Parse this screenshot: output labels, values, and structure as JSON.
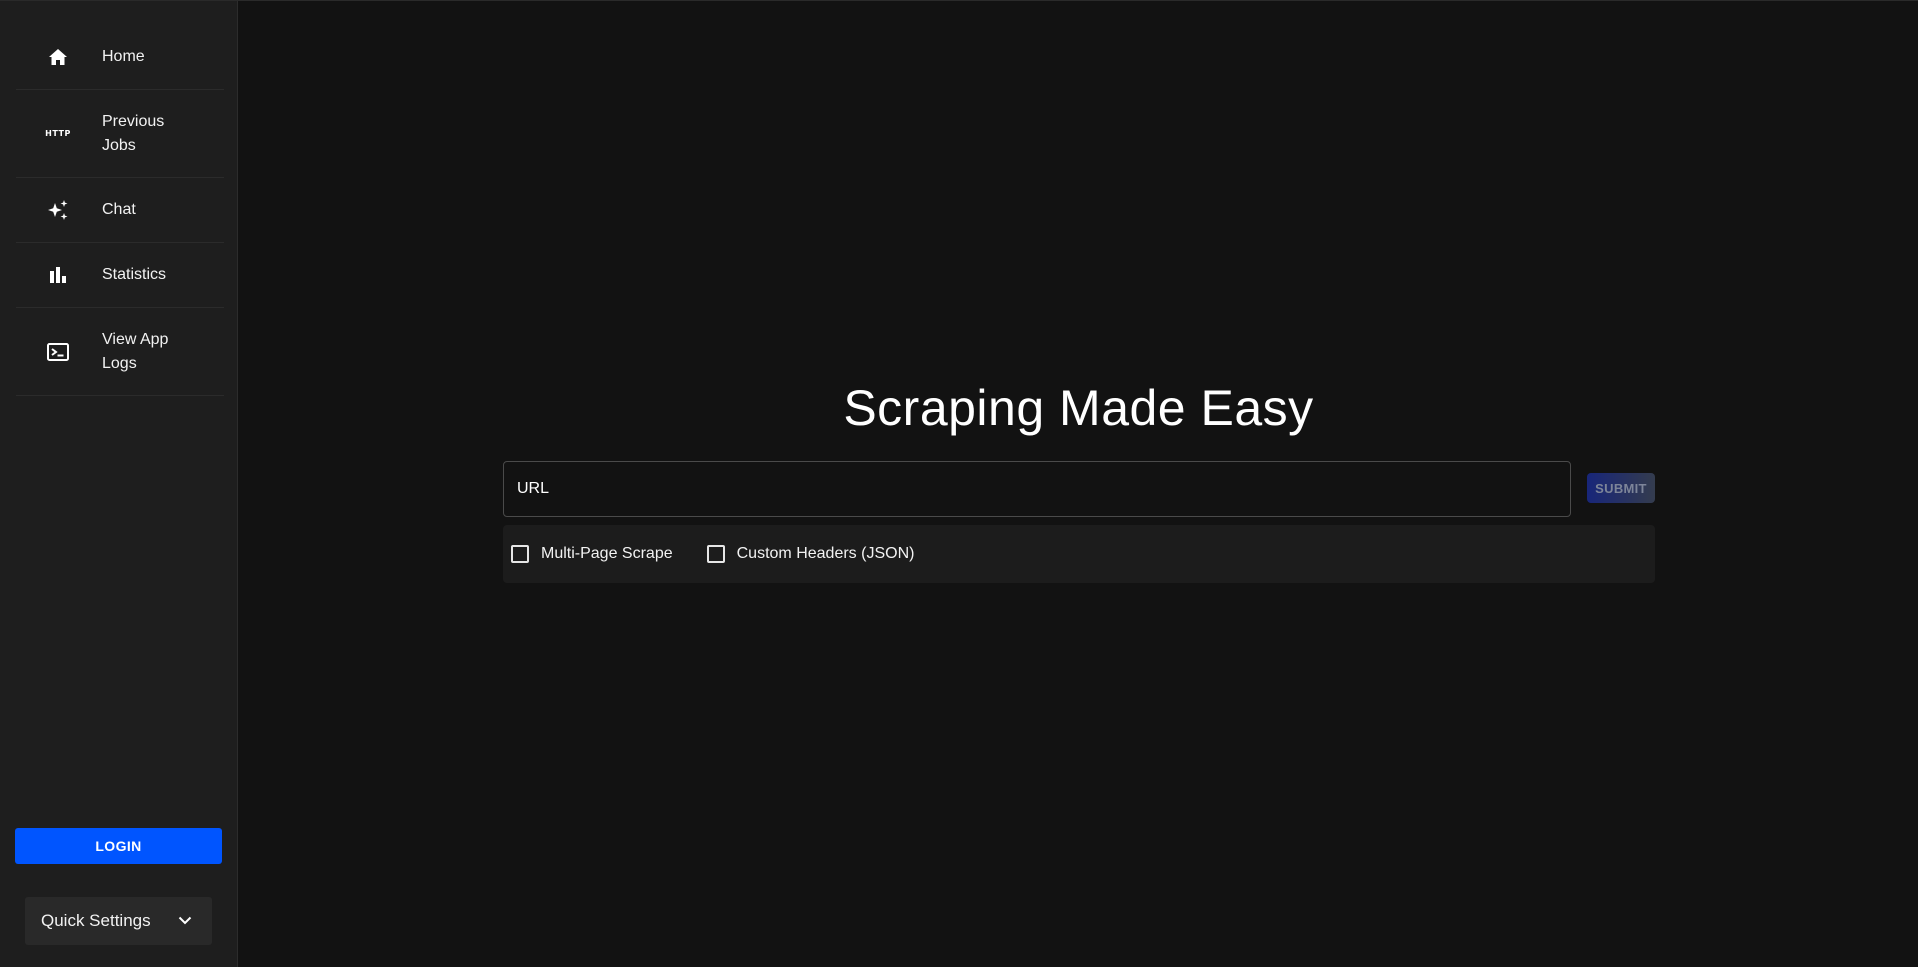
{
  "sidebar": {
    "items": [
      {
        "label": "Home",
        "icon": "home-icon"
      },
      {
        "label": "Previous Jobs",
        "icon": "http-icon",
        "icon_text": "HTTP"
      },
      {
        "label": "Chat",
        "icon": "sparkles-icon"
      },
      {
        "label": "Statistics",
        "icon": "bar-chart-icon"
      },
      {
        "label": "View App Logs",
        "icon": "terminal-icon"
      }
    ],
    "login_label": "LOGIN",
    "quick_settings_label": "Quick Settings"
  },
  "main": {
    "title": "Scraping Made Easy",
    "url_placeholder": "URL",
    "url_value": "",
    "submit_label": "SUBMIT",
    "options": [
      {
        "label": "Multi-Page Scrape",
        "checked": false
      },
      {
        "label": "Custom Headers (JSON)",
        "checked": false
      }
    ]
  },
  "colors": {
    "background": "#121212",
    "sidebar": "#1e1e1e",
    "accent": "#0055ff",
    "panel": "#1c1c1c"
  }
}
